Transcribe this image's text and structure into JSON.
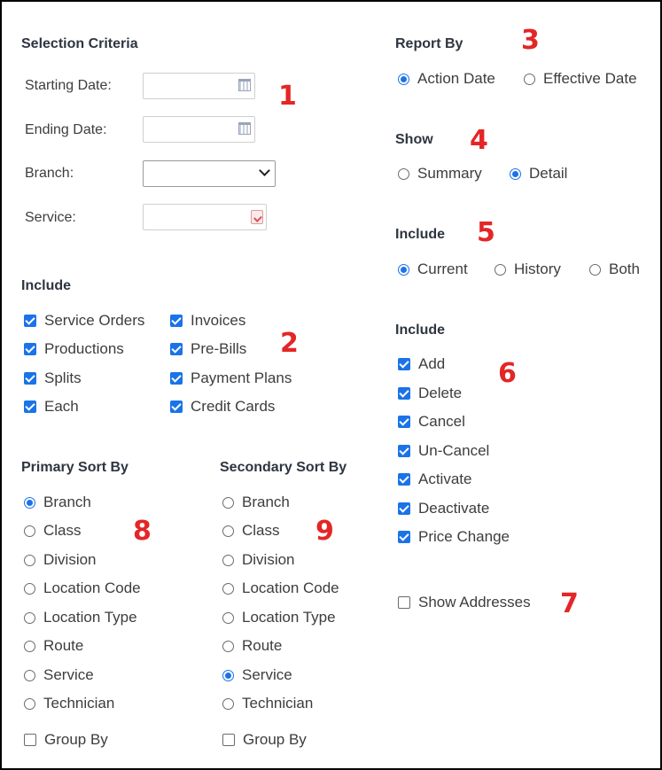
{
  "selection": {
    "header": "Selection Criteria",
    "starting_date_label": "Starting Date:",
    "ending_date_label": "Ending Date:",
    "branch_label": "Branch:",
    "service_label": "Service:"
  },
  "include_left": {
    "header": "Include",
    "items": [
      {
        "label": "Service Orders",
        "checked": true
      },
      {
        "label": "Productions",
        "checked": true
      },
      {
        "label": "Splits",
        "checked": true
      },
      {
        "label": "Each",
        "checked": true
      },
      {
        "label": "Invoices",
        "checked": true
      },
      {
        "label": "Pre-Bills",
        "checked": true
      },
      {
        "label": "Payment Plans",
        "checked": true
      },
      {
        "label": "Credit Cards",
        "checked": true
      }
    ]
  },
  "report_by": {
    "header": "Report By",
    "options": [
      {
        "label": "Action Date",
        "selected": true
      },
      {
        "label": "Effective Date",
        "selected": false
      }
    ]
  },
  "show": {
    "header": "Show",
    "options": [
      {
        "label": "Summary",
        "selected": false
      },
      {
        "label": "Detail",
        "selected": true
      }
    ]
  },
  "include_status": {
    "header": "Include",
    "options": [
      {
        "label": "Current",
        "selected": true
      },
      {
        "label": "History",
        "selected": false
      },
      {
        "label": "Both",
        "selected": false
      }
    ]
  },
  "include_actions": {
    "header": "Include",
    "items": [
      {
        "label": "Add",
        "checked": true
      },
      {
        "label": "Delete",
        "checked": true
      },
      {
        "label": "Cancel",
        "checked": true
      },
      {
        "label": "Un-Cancel",
        "checked": true
      },
      {
        "label": "Activate",
        "checked": true
      },
      {
        "label": "Deactivate",
        "checked": true
      },
      {
        "label": "Price Change",
        "checked": true
      }
    ]
  },
  "show_addresses": {
    "label": "Show Addresses",
    "checked": false
  },
  "primary_sort": {
    "header": "Primary Sort By",
    "options": [
      {
        "label": "Branch",
        "selected": true
      },
      {
        "label": "Class",
        "selected": false
      },
      {
        "label": "Division",
        "selected": false
      },
      {
        "label": "Location Code",
        "selected": false
      },
      {
        "label": "Location Type",
        "selected": false
      },
      {
        "label": "Route",
        "selected": false
      },
      {
        "label": "Service",
        "selected": false
      },
      {
        "label": "Technician",
        "selected": false
      }
    ],
    "group_by": {
      "label": "Group By",
      "checked": false
    }
  },
  "secondary_sort": {
    "header": "Secondary Sort By",
    "options": [
      {
        "label": "Branch",
        "selected": false
      },
      {
        "label": "Class",
        "selected": false
      },
      {
        "label": "Division",
        "selected": false
      },
      {
        "label": "Location Code",
        "selected": false
      },
      {
        "label": "Location Type",
        "selected": false
      },
      {
        "label": "Route",
        "selected": false
      },
      {
        "label": "Service",
        "selected": true
      },
      {
        "label": "Technician",
        "selected": false
      }
    ],
    "group_by": {
      "label": "Group By",
      "checked": false
    }
  },
  "annotations": [
    "1",
    "2",
    "3",
    "4",
    "5",
    "6",
    "7",
    "8",
    "9"
  ],
  "colors": {
    "accent": "#1a73e8",
    "annotation": "#e32626",
    "header": "#2e3540"
  }
}
